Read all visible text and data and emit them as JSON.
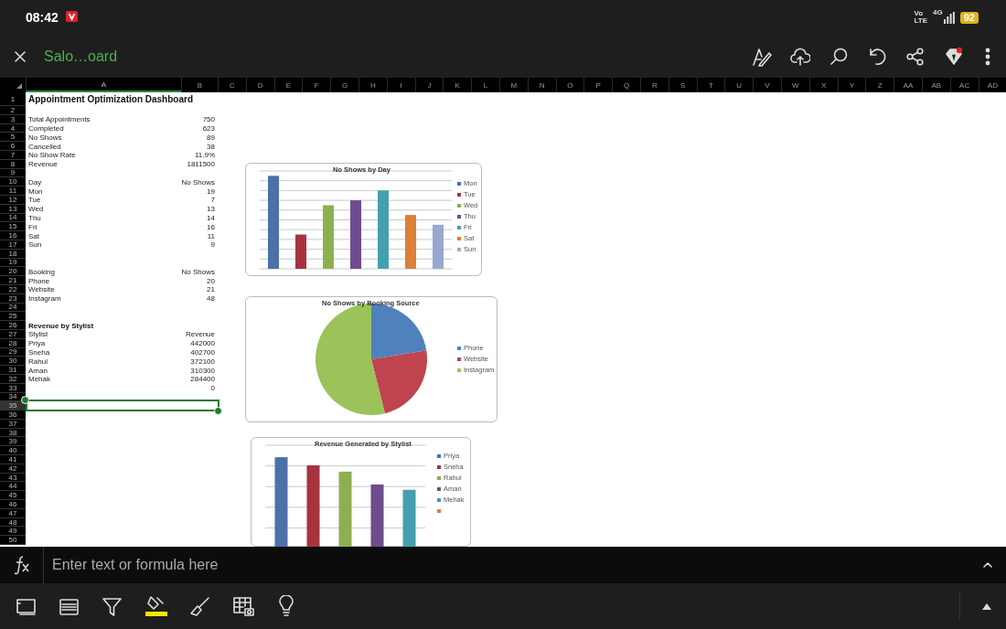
{
  "status_bar": {
    "time": "08:42",
    "volte": [
      "Vo",
      "LTE"
    ],
    "network": "4G",
    "battery": "92"
  },
  "toolbar": {
    "title": "Salo…oard"
  },
  "sheet": {
    "columns": [
      {
        "label": "A",
        "selected": true
      },
      {
        "label": "B",
        "selected": false
      },
      {
        "label": "C",
        "selected": false
      },
      {
        "label": "D",
        "selected": false
      },
      {
        "label": "E",
        "selected": false
      },
      {
        "label": "F",
        "selected": false
      },
      {
        "label": "G",
        "selected": false
      },
      {
        "label": "H",
        "selected": false
      },
      {
        "label": "I",
        "selected": false
      },
      {
        "label": "J",
        "selected": false
      },
      {
        "label": "K",
        "selected": false
      },
      {
        "label": "L",
        "selected": false
      },
      {
        "label": "M",
        "selected": false
      },
      {
        "label": "N",
        "selected": false
      },
      {
        "label": "O",
        "selected": false
      },
      {
        "label": "P",
        "selected": false
      },
      {
        "label": "Q",
        "selected": false
      },
      {
        "label": "R",
        "selected": false
      },
      {
        "label": "S",
        "selected": false
      },
      {
        "label": "T",
        "selected": false
      },
      {
        "label": "U",
        "selected": false
      },
      {
        "label": "V",
        "selected": false
      },
      {
        "label": "W",
        "selected": false
      },
      {
        "label": "X",
        "selected": false
      },
      {
        "label": "Y",
        "selected": false
      },
      {
        "label": "Z",
        "selected": false
      },
      {
        "label": "AA",
        "selected": false
      },
      {
        "label": "AB",
        "selected": false
      },
      {
        "label": "AC",
        "selected": false
      },
      {
        "label": "AD",
        "selected": false
      }
    ],
    "rows": [
      {
        "number": "1",
        "kind": "title",
        "a": "Appointment Optimization Dashboard",
        "selected": false
      },
      {
        "number": "2",
        "selected": false
      },
      {
        "number": "3",
        "a": "Total Appointments",
        "b": "750",
        "selected": false
      },
      {
        "number": "4",
        "a": "Completed",
        "b": "623",
        "selected": false
      },
      {
        "number": "5",
        "a": "No Shows",
        "b": "89",
        "selected": false
      },
      {
        "number": "6",
        "a": "Cancelled",
        "b": "38",
        "selected": false
      },
      {
        "number": "7",
        "a": "No Show Rate",
        "b": "11.9%",
        "selected": false
      },
      {
        "number": "8",
        "a": "Revenue",
        "b": "1811500",
        "selected": false
      },
      {
        "number": "9",
        "selected": false
      },
      {
        "number": "10",
        "a": "Day",
        "b": "No Shows",
        "selected": false
      },
      {
        "number": "11",
        "a": "Mon",
        "b": "19",
        "selected": false
      },
      {
        "number": "12",
        "a": "Tue",
        "b": "7",
        "selected": false
      },
      {
        "number": "13",
        "a": "Wed",
        "b": "13",
        "selected": false
      },
      {
        "number": "14",
        "a": "Thu",
        "b": "14",
        "selected": false
      },
      {
        "number": "15",
        "a": "Fri",
        "b": "16",
        "selected": false
      },
      {
        "number": "16",
        "a": "Sat",
        "b": "11",
        "selected": false
      },
      {
        "number": "17",
        "a": "Sun",
        "b": "9",
        "selected": false
      },
      {
        "number": "18",
        "selected": false
      },
      {
        "number": "19",
        "selected": false
      },
      {
        "number": "20",
        "a": "Booking",
        "b": "No Shows",
        "selected": false
      },
      {
        "number": "21",
        "a": "Phone",
        "b": "20",
        "selected": false
      },
      {
        "number": "22",
        "a": "Website",
        "b": "21",
        "selected": false
      },
      {
        "number": "23",
        "a": "Instagram",
        "b": "48",
        "selected": false
      },
      {
        "number": "24",
        "selected": false
      },
      {
        "number": "25",
        "selected": false
      },
      {
        "number": "26",
        "kind": "heading",
        "a": "Revenue by Stylist",
        "selected": false
      },
      {
        "number": "27",
        "a": "Stylist",
        "b": "Revenue",
        "selected": false
      },
      {
        "number": "28",
        "a": "Priya",
        "b": "442000",
        "selected": false
      },
      {
        "number": "29",
        "a": "Sneha",
        "b": "402700",
        "selected": false
      },
      {
        "number": "30",
        "a": "Rahul",
        "b": "372100",
        "selected": false
      },
      {
        "number": "31",
        "a": "Aman",
        "b": "310300",
        "selected": false
      },
      {
        "number": "32",
        "a": "Mehak",
        "b": "284400",
        "selected": false
      },
      {
        "number": "33",
        "b": "0",
        "selected": false
      },
      {
        "number": "34",
        "selected": false
      },
      {
        "number": "35",
        "selected": true
      },
      {
        "number": "36",
        "selected": false
      },
      {
        "number": "37",
        "selected": false
      },
      {
        "number": "38",
        "selected": false
      },
      {
        "number": "39",
        "selected": false
      },
      {
        "number": "40",
        "selected": false
      },
      {
        "number": "41",
        "selected": false
      },
      {
        "number": "42",
        "selected": false
      },
      {
        "number": "43",
        "selected": false
      },
      {
        "number": "44",
        "selected": false
      },
      {
        "number": "45",
        "selected": false
      },
      {
        "number": "46",
        "selected": false
      },
      {
        "number": "47",
        "selected": false
      },
      {
        "number": "48",
        "selected": false
      },
      {
        "number": "49",
        "selected": false
      },
      {
        "number": "50",
        "selected": false
      }
    ]
  },
  "charts": [
    {
      "kind": "bar",
      "title": "No Shows by Day",
      "legend": [
        {
          "label": "Mon",
          "color": "#4a72a8"
        },
        {
          "label": "Tue",
          "color": "#a8333f"
        },
        {
          "label": "Wed",
          "color": "#8cb050"
        },
        {
          "label": "Thu",
          "color": "#6e4c8e"
        },
        {
          "label": "Fri",
          "color": "#44a0b0"
        },
        {
          "label": "Sat",
          "color": "#dc8038"
        },
        {
          "label": "Sun",
          "color": "#98a8d0"
        }
      ]
    },
    {
      "kind": "pie",
      "title": "No Shows by Booking Source",
      "legend": [
        {
          "label": "Phone",
          "color": "#4f81bd"
        },
        {
          "label": "Website",
          "color": "#c0444f"
        },
        {
          "label": "Instagram",
          "color": "#9bc35a"
        }
      ]
    },
    {
      "kind": "bar",
      "title": "Revenue Generated by Stylist",
      "legend": [
        {
          "label": "Priya",
          "color": "#4a72a8"
        },
        {
          "label": "Sneha",
          "color": "#a8333f"
        },
        {
          "label": "Rahul",
          "color": "#8cb050"
        },
        {
          "label": "Aman",
          "color": "#6e4c8e"
        },
        {
          "label": "Mehak",
          "color": "#44a0b0"
        },
        {
          "color": "#dc8038"
        }
      ]
    }
  ],
  "formula_bar": {
    "placeholder": "Enter text or formula here"
  }
}
